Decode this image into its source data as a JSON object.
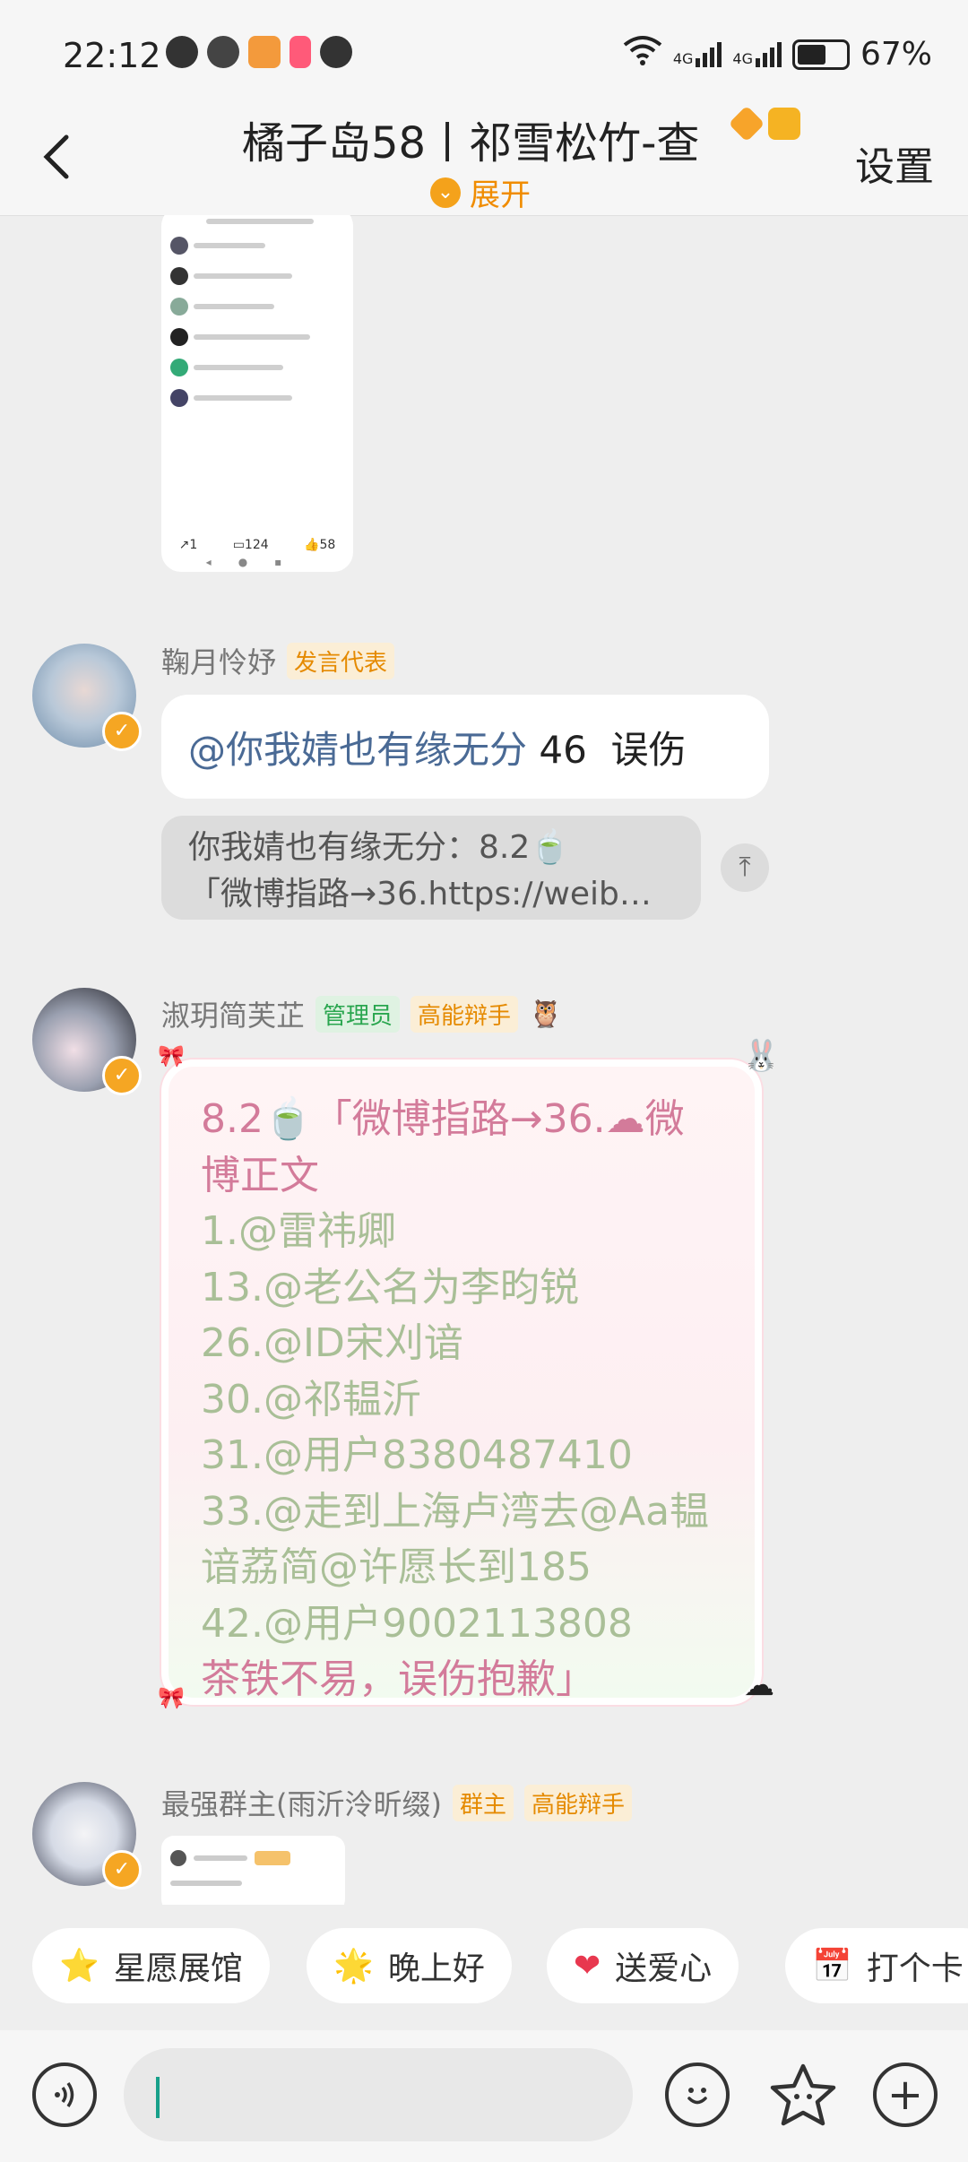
{
  "status": {
    "time": "22:12",
    "network1": "4G",
    "network2": "4G",
    "battery": "67%",
    "battery_level": 0.67
  },
  "header": {
    "title": "橘子岛58丨祁雪松竹-查",
    "expand_label": "展开",
    "settings_label": "设置"
  },
  "screenshot_preview": {
    "repost_count": "1",
    "comment_count": "124",
    "like_count": "58"
  },
  "messages": [
    {
      "sender": "鞠月怜妤",
      "tags": [
        "发言代表"
      ],
      "mention": "@你我婧也有缘无分",
      "text": " 46  误伤",
      "quote_line1": "你我婧也有缘无分：8.2🍵",
      "quote_line2": "「微博指路→36.https://weib…"
    },
    {
      "sender": "淑玥简芙芷",
      "tags": [
        "管理员",
        "高能辩手"
      ],
      "card_lines": [
        "8.2🍵「微博指路→36.☁微",
        "博正文",
        "1.@雷祎卿",
        "13.@老公名为李昀锐",
        "26.@ID宋刈谙",
        "30.@祁韫沂",
        "31.@用户8380487410",
        "33.@走到上海卢湾去@Aa韫",
        "谙荔简@许愿长到185",
        "42.@用户9002113808",
        "茶铁不易，误伤抱歉」"
      ]
    },
    {
      "sender": "最强群主(雨沂泠昕缀)",
      "tags": [
        "群主",
        "高能辩手"
      ]
    }
  ],
  "quick_replies": [
    {
      "icon": "star-icon",
      "label": "星愿展馆"
    },
    {
      "icon": "star-face-icon",
      "label": "晚上好"
    },
    {
      "icon": "heart-icon",
      "label": "送爱心"
    },
    {
      "icon": "calendar-icon",
      "label": "打个卡"
    }
  ],
  "input": {
    "placeholder": ""
  }
}
